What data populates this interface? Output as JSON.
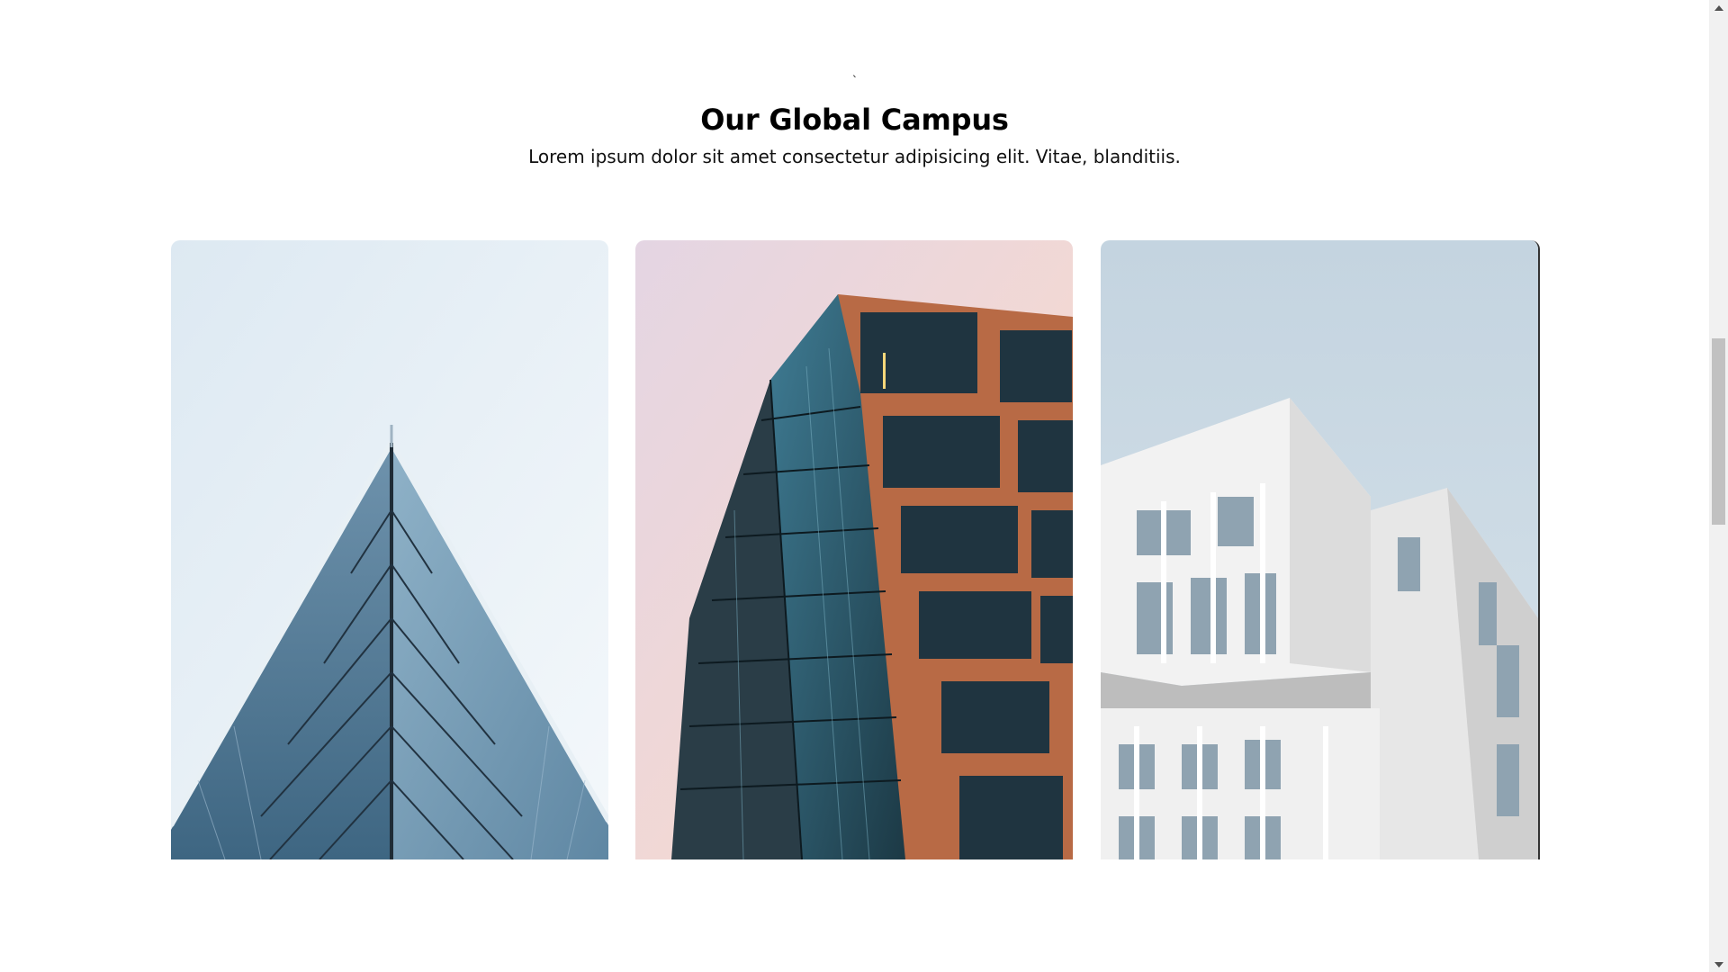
{
  "section": {
    "tick": "`",
    "title": "Our Global Campus",
    "subtitle": "Lorem ipsum dolor sit amet consectetur adipisicing elit. Vitae, blanditiis."
  },
  "gallery": {
    "images": [
      {
        "subject": "glass-pyramid-building"
      },
      {
        "subject": "glass-copper-tower"
      },
      {
        "subject": "white-modular-building"
      }
    ]
  },
  "scrollbar": {
    "position_fraction": 0.38
  }
}
